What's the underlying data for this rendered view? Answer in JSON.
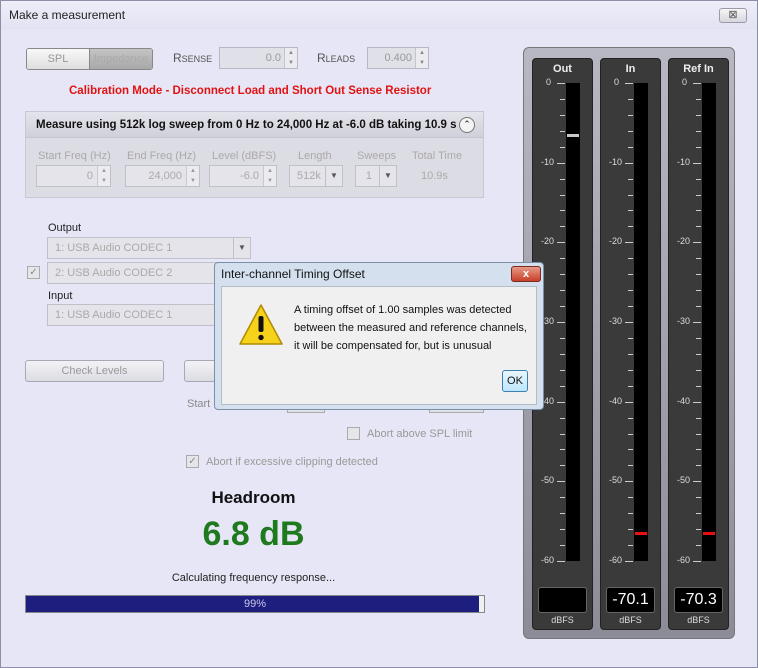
{
  "window": {
    "title": "Make a measurement",
    "close": "⊠"
  },
  "mode": {
    "spl": "SPL",
    "impedance": "Impedance"
  },
  "rsense": {
    "label_main": "R",
    "label_sub": "SENSE",
    "value": "0.0"
  },
  "rleads": {
    "label_main": "R",
    "label_sub": "LEADS",
    "value": "0.400"
  },
  "calibration_text": "Calibration Mode - Disconnect Load and Short Out Sense Resistor",
  "sweep": {
    "title": "Measure using 512k log sweep from 0 Hz to 24,000 Hz at -6.0 dB taking 10.9 s",
    "headers": [
      "Start Freq (Hz)",
      "End Freq (Hz)",
      "Level (dBFS)",
      "Length",
      "Sweeps",
      "Total Time"
    ],
    "start_freq": "0",
    "end_freq": "24,000",
    "level": "-6.0",
    "length": "512k",
    "sweeps": "1",
    "total_time": "10.9s"
  },
  "io": {
    "output_label": "Output",
    "output_value": "1: USB Audio CODEC  1",
    "ref_value": "2: USB Audio CODEC  2",
    "input_label": "Input",
    "input_value": "1: USB Audio CODEC  1"
  },
  "buttons": {
    "check_levels": "Check Levels"
  },
  "start_label": "Start",
  "abort_spl": "Abort above SPL limit",
  "abort_clip": "Abort if excessive clipping detected",
  "headroom": {
    "title": "Headroom",
    "value": "6.8 dB"
  },
  "status": "Calculating frequency response...",
  "progress": {
    "percent": 99,
    "label": "99%"
  },
  "meters": [
    {
      "title": "Out",
      "readout": "",
      "unit": "dBFS",
      "level": -6.5,
      "marker_color": "#c8c8c8"
    },
    {
      "title": "In",
      "readout": "-70.1",
      "unit": "dBFS",
      "level": -56.5,
      "marker_color": "#e81010"
    },
    {
      "title": "Ref In",
      "readout": "-70.3",
      "unit": "dBFS",
      "level": -56.5,
      "marker_color": "#e81010"
    }
  ],
  "meter_scale": [
    "0",
    "-10",
    "-20",
    "-30",
    "-40",
    "-50",
    "-60"
  ],
  "dialog": {
    "title": "Inter-channel Timing Offset",
    "close": "x",
    "lines": [
      "A timing offset of 1.00 samples was detected",
      "between the measured and reference channels,",
      "it will be compensated for, but is unusual"
    ],
    "ok": "OK"
  }
}
